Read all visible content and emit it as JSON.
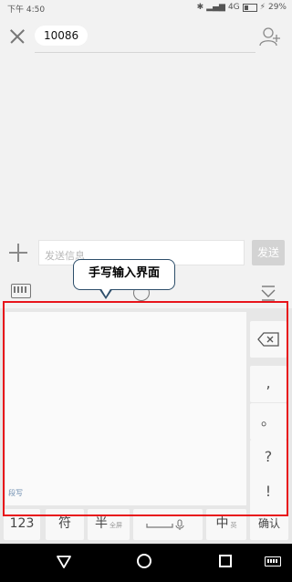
{
  "status_bar": {
    "time": "下午 4:50",
    "signal_text": "4G",
    "battery": "29%"
  },
  "header": {
    "recipient": "10086"
  },
  "compose": {
    "placeholder": "发送信息",
    "send_label": "发送"
  },
  "annotation": {
    "callout_text": "手写输入界面",
    "highlight_color": "#e8141b"
  },
  "keyboard": {
    "handwriting_label": "段写",
    "side_keys": [
      ",",
      "。",
      "?",
      "!"
    ],
    "bottom_keys": {
      "num": "123",
      "symbol": "符",
      "half": "半",
      "half_sub": "全屏",
      "lang": "中",
      "lang_sub": "英",
      "confirm": "确认"
    }
  },
  "icons": [
    "close-icon",
    "add-contact-icon",
    "add-attachment-icon",
    "keyboard-icon",
    "emoji-icon",
    "collapse-keyboard-icon",
    "backspace-icon",
    "microphone-icon",
    "nav-back-icon",
    "nav-home-icon",
    "nav-recents-icon",
    "nav-keyboard-icon"
  ]
}
